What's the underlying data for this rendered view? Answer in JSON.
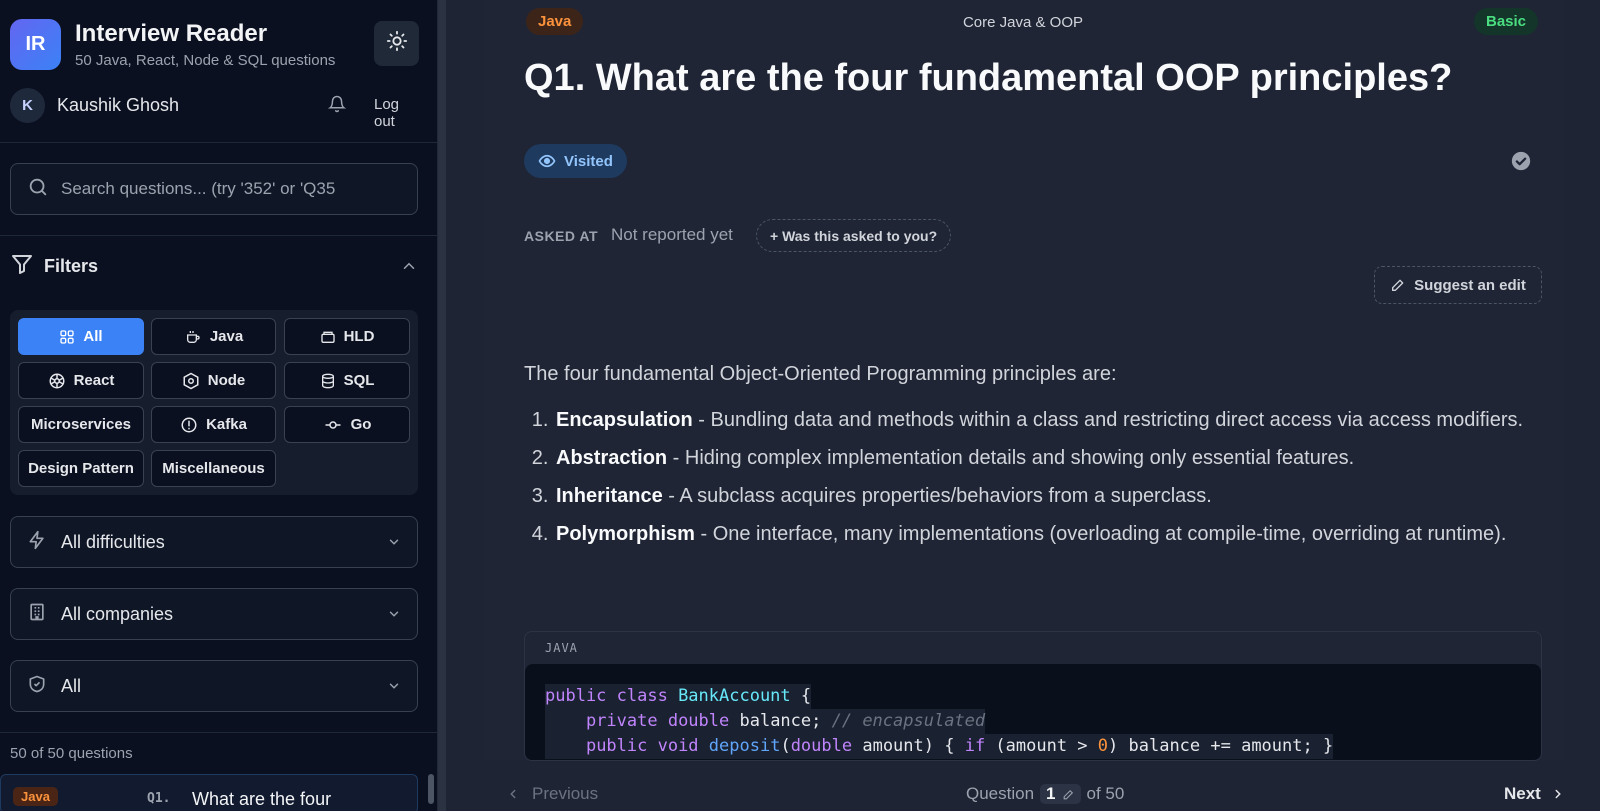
{
  "app": {
    "logo_text": "IR",
    "title": "Interview Reader",
    "subtitle": "50 Java, React, Node & SQL questions"
  },
  "user": {
    "initial": "K",
    "name": "Kaushik Ghosh",
    "logout_label": "Log out"
  },
  "search": {
    "placeholder": "Search questions... (try '352' or 'Q35"
  },
  "filters": {
    "title": "Filters",
    "chips": [
      {
        "label": "All",
        "icon": "grid-icon",
        "active": true
      },
      {
        "label": "Java",
        "icon": "coffee-cup-icon"
      },
      {
        "label": "HLD",
        "icon": "layers-icon"
      },
      {
        "label": "React",
        "icon": "atom-icon"
      },
      {
        "label": "Node",
        "icon": "hexagon-icon"
      },
      {
        "label": "SQL",
        "icon": "database-icon"
      },
      {
        "label": "Microservices"
      },
      {
        "label": "Kafka",
        "icon": "alert-circle-icon"
      },
      {
        "label": "Go",
        "icon": "git-commit-icon"
      },
      {
        "label": "Design Pattern"
      },
      {
        "label": "Miscellaneous"
      }
    ],
    "difficulty": "All difficulties",
    "companies": "All companies",
    "status": "All"
  },
  "question_count": "50 of 50 questions",
  "list": [
    {
      "tag": "Java",
      "num": "Q1.",
      "title": "What are the four"
    }
  ],
  "question": {
    "topic_tag": "Java",
    "category": "Core Java & OOP",
    "difficulty": "Basic",
    "heading": "Q1. What are the four fundamental OOP principles?",
    "visited_label": "Visited",
    "asked_label": "ASKED AT",
    "asked_value": "Not reported yet",
    "asked_button": "+ Was this asked to you?",
    "suggest_label": "Suggest an edit",
    "intro": "The four fundamental Object-Oriented Programming principles are:",
    "points": [
      {
        "term": "Encapsulation",
        "text": " - Bundling data and methods within a class and restricting direct access via access modifiers."
      },
      {
        "term": "Abstraction",
        "text": " - Hiding complex implementation details and showing only essential features."
      },
      {
        "term": "Inheritance",
        "text": " - A subclass acquires properties/behaviors from a superclass."
      },
      {
        "term": "Polymorphism",
        "text": " - One interface, many implementations (overloading at compile-time, overriding at runtime)."
      }
    ],
    "code_lang": "JAVA",
    "code_lines": [
      [
        {
          "t": "public class ",
          "c": "kw"
        },
        {
          "t": "BankAccount",
          "c": "ty"
        },
        {
          "t": " {",
          "c": ""
        }
      ],
      [
        {
          "t": "    ",
          "c": ""
        },
        {
          "t": "private double ",
          "c": "kw"
        },
        {
          "t": "balance; ",
          "c": ""
        },
        {
          "t": "// encapsulated",
          "c": "cm"
        }
      ],
      [
        {
          "t": "    ",
          "c": ""
        },
        {
          "t": "public void ",
          "c": "kw"
        },
        {
          "t": "deposit",
          "c": "fn"
        },
        {
          "t": "(",
          "c": ""
        },
        {
          "t": "double",
          "c": "kw"
        },
        {
          "t": " amount) { ",
          "c": ""
        },
        {
          "t": "if",
          "c": "kw"
        },
        {
          "t": " (amount > ",
          "c": ""
        },
        {
          "t": "0",
          "c": "num"
        },
        {
          "t": ") balance += amount; }",
          "c": ""
        }
      ]
    ]
  },
  "nav": {
    "previous": "Previous",
    "question_label": "Question",
    "current": "1",
    "of_total": "of 50",
    "next": "Next"
  },
  "colors": {
    "accent": "#3b82f6",
    "java_tag": "#fb923c",
    "basic_tag": "#4ade80"
  }
}
